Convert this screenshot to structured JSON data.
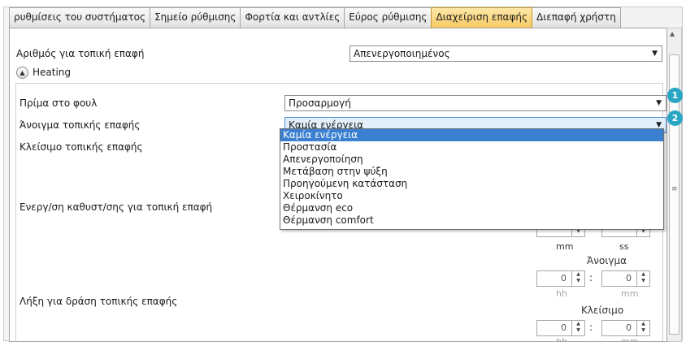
{
  "tabs": [
    {
      "label": "ρυθμίσεις του συστήματος",
      "active": false
    },
    {
      "label": "Σημείο ρύθμισης",
      "active": false
    },
    {
      "label": "Φορτία και αντλίες",
      "active": false
    },
    {
      "label": "Εύρος ρύθμισης",
      "active": false
    },
    {
      "label": "Διαχείριση επαφής",
      "active": true
    },
    {
      "label": "Διεπαφή χρήστη",
      "active": false
    }
  ],
  "local_contact_number": {
    "label": "Αριθμός για τοπική επαφή",
    "value": "Απενεργοποιημένος"
  },
  "section": {
    "title": "Heating",
    "icon": "chevron-up-icon"
  },
  "floor_bonus": {
    "label": "Πρίμα στο φουλ",
    "value": "Προσαρμογή"
  },
  "contact_open": {
    "label": "Άνοιγμα τοπικής επαφής",
    "value": "Καμία ενέργεια"
  },
  "contact_close": {
    "label": "Κλείσιμο τοπικής επαφής"
  },
  "delay_activation": {
    "label": "Ενεργ/ση καθυστ/σης για τοπική επαφή",
    "unit_mm": "mm",
    "unit_ss": "ss"
  },
  "action_expiry": {
    "label": "Λήξη για δράση τοπικής επαφής",
    "open_label": "Άνοιγμα",
    "close_label": "Κλείσιμο",
    "open_hh": "0",
    "open_mm": "0",
    "close_hh": "0",
    "close_mm": "0",
    "unit_hh": "hh",
    "unit_mm": "mm",
    "separator": ":"
  },
  "dropdown_options": [
    {
      "label": "Καμία ενέργεια",
      "selected": true
    },
    {
      "label": "Προστασία",
      "selected": false
    },
    {
      "label": "Απενεργοποίηση",
      "selected": false
    },
    {
      "label": "Μετάβαση στην ψύξη",
      "selected": false
    },
    {
      "label": "Προηγούμενη κατάσταση",
      "selected": false
    },
    {
      "label": "Χειροκίνητο",
      "selected": false
    },
    {
      "label": "Θέρμανση eco",
      "selected": false
    },
    {
      "label": "Θέρμανση comfort",
      "selected": false
    }
  ],
  "callouts": {
    "first": "1",
    "second": "2"
  },
  "colors": {
    "active_tab": "#f7c963",
    "selection": "#3b7fd0",
    "callout": "#2aa6c5"
  }
}
